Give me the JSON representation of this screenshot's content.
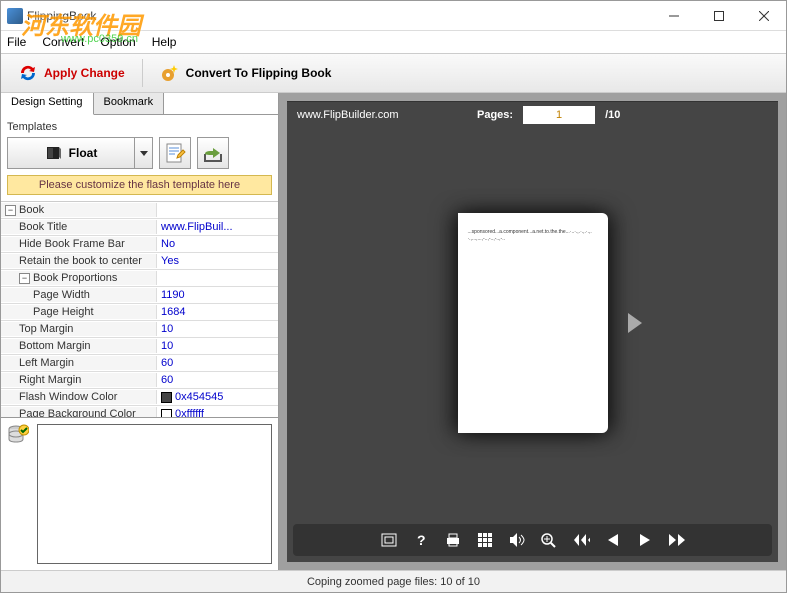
{
  "window": {
    "title": "FlippingBook",
    "watermark": "河东软件园",
    "watermark_url": "www.pc0359.cn"
  },
  "menu": [
    "File",
    "Convert",
    "Option",
    "Help"
  ],
  "toolbar": {
    "apply_label": "Apply Change",
    "convert_label": "Convert To Flipping Book"
  },
  "tabs": {
    "design": "Design Setting",
    "bookmark": "Bookmark",
    "active": "design"
  },
  "templates": {
    "label": "Templates",
    "selected": "Float",
    "customize": "Please customize the flash template here"
  },
  "properties": [
    {
      "type": "group",
      "label": "Book",
      "expanded": true
    },
    {
      "type": "item",
      "indent": 1,
      "label": "Book Title",
      "value": "www.FlipBuil..."
    },
    {
      "type": "item",
      "indent": 1,
      "label": "Hide Book Frame Bar",
      "value": "No"
    },
    {
      "type": "item",
      "indent": 1,
      "label": "Retain the book to center",
      "value": "Yes"
    },
    {
      "type": "group",
      "indent": 1,
      "label": "Book Proportions",
      "expanded": true
    },
    {
      "type": "item",
      "indent": 2,
      "label": "Page Width",
      "value": "1190"
    },
    {
      "type": "item",
      "indent": 2,
      "label": "Page Height",
      "value": "1684"
    },
    {
      "type": "item",
      "indent": 1,
      "label": "Top Margin",
      "value": "10"
    },
    {
      "type": "item",
      "indent": 1,
      "label": "Bottom Margin",
      "value": "10"
    },
    {
      "type": "item",
      "indent": 1,
      "label": "Left Margin",
      "value": "60"
    },
    {
      "type": "item",
      "indent": 1,
      "label": "Right Margin",
      "value": "60"
    },
    {
      "type": "item",
      "indent": 1,
      "label": "Flash Window Color",
      "value": "0x454545",
      "swatch": "#454545"
    },
    {
      "type": "item",
      "indent": 1,
      "label": "Page Background Color",
      "value": "0xffffff",
      "swatch": "#ffffff"
    }
  ],
  "viewer": {
    "url": "www.FlipBuilder.com",
    "pages_label": "Pages:",
    "current": "1",
    "total": "/10",
    "page_text": "...sponsored...a.component...a.net.to.the.the...·..·.,.·.,.·.,.·.,...,...,-..,-..,-..,-.."
  },
  "viewer_icons": [
    "frame",
    "help",
    "print",
    "thumbnails",
    "sound",
    "zoom",
    "first",
    "prev",
    "next",
    "last"
  ],
  "status": "Coping zoomed page files: 10 of 10"
}
